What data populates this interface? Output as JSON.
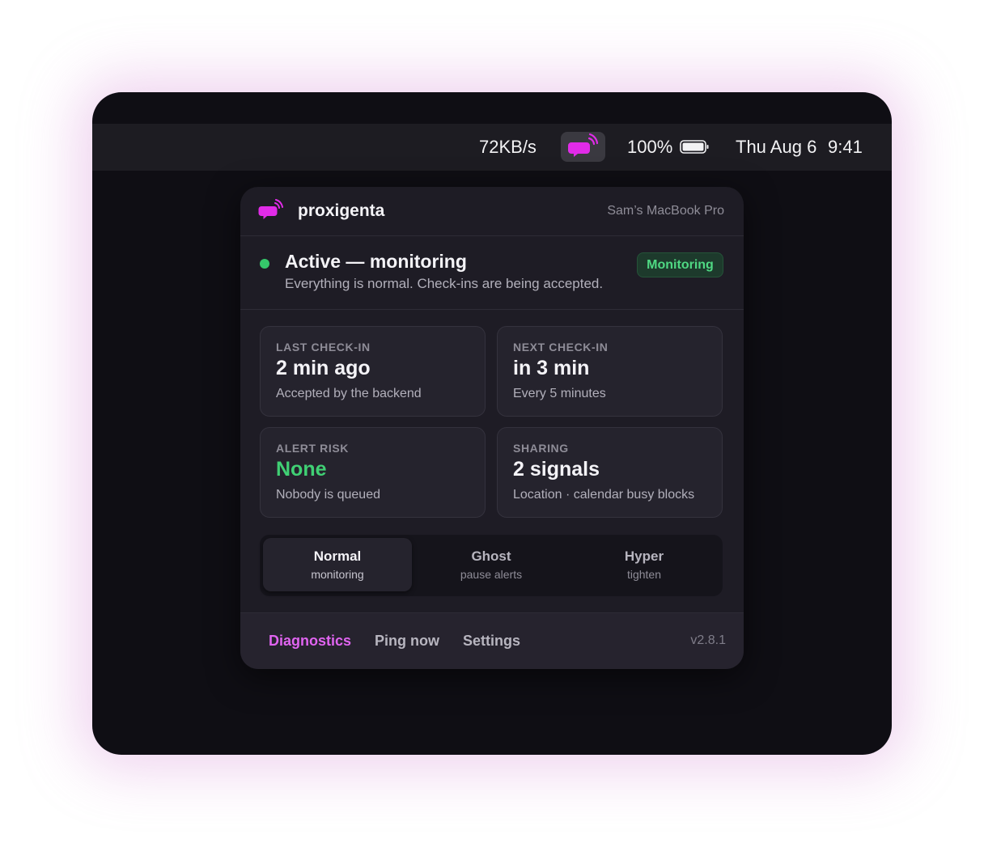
{
  "menubar": {
    "network_speed": "72KB/s",
    "battery_percent": "100%",
    "battery_level": 1.0,
    "date": "Thu Aug 6",
    "time": "9:41",
    "app_icon": "chat-broadcast-icon"
  },
  "panel": {
    "app_name": "proxigenta",
    "device_name": "Sam’s MacBook Pro",
    "status": {
      "title": "Active — monitoring",
      "description": "Everything is normal. Check-ins are being accepted.",
      "badge": "Monitoring"
    },
    "cards": [
      {
        "label": "Last check-in",
        "value": "2 min ago",
        "sub": "Accepted by the backend"
      },
      {
        "label": "Next check-in",
        "value": "in 3 min",
        "sub": "Every 5 minutes"
      },
      {
        "label": "Alert risk",
        "value": "None",
        "sub": "Nobody is queued"
      },
      {
        "label": "Sharing",
        "value": "2 signals",
        "sub": "Location · calendar busy blocks"
      }
    ],
    "modes": [
      {
        "name": "Normal",
        "sub": "monitoring"
      },
      {
        "name": "Ghost",
        "sub": "pause alerts"
      },
      {
        "name": "Hyper",
        "sub": "tighten"
      }
    ],
    "active_mode": "Normal",
    "footer": {
      "diagnostics": "Diagnostics",
      "ping": "Ping now",
      "settings": "Settings",
      "version": "v2.8.1"
    }
  },
  "colors": {
    "accent": "#e064f0",
    "status_green": "#35c76a",
    "background": "#0f0e14",
    "panel": "#1e1c25"
  }
}
